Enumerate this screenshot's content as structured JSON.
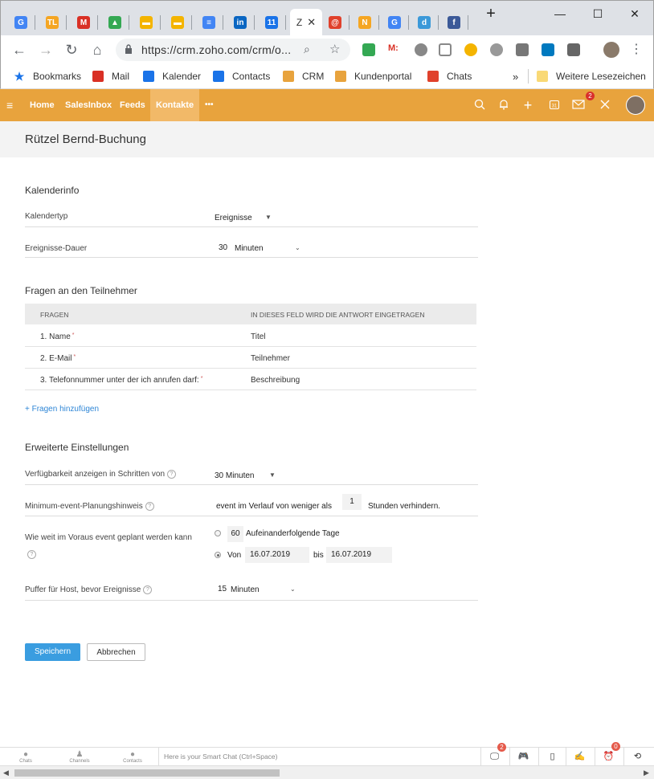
{
  "browser": {
    "active_tab_title": "Z",
    "tabs": [
      {
        "icon": "google-icon",
        "glyph": "G",
        "color": "#4285f4"
      },
      {
        "icon": "tl-icon",
        "glyph": "TL",
        "color": "#f5a623"
      },
      {
        "icon": "gmail-icon",
        "glyph": "M",
        "color": "#d93025"
      },
      {
        "icon": "google-drive-icon",
        "glyph": "▲",
        "color": "#34a853"
      },
      {
        "icon": "google-slides-icon",
        "glyph": "▬",
        "color": "#f4b400"
      },
      {
        "icon": "google-slides-icon",
        "glyph": "▬",
        "color": "#f4b400"
      },
      {
        "icon": "google-docs-icon",
        "glyph": "≡",
        "color": "#4285f4"
      },
      {
        "icon": "linkedin-icon",
        "glyph": "in",
        "color": "#0a66c2"
      },
      {
        "icon": "calendar-icon",
        "glyph": "11",
        "color": "#1a73e8"
      }
    ],
    "tabs_after": [
      {
        "icon": "zoho-chat-icon",
        "glyph": "@",
        "color": "#e0412c"
      },
      {
        "icon": "n-icon",
        "glyph": "N",
        "color": "#f5a623"
      },
      {
        "icon": "google-icon",
        "glyph": "G",
        "color": "#4285f4"
      },
      {
        "icon": "d-icon",
        "glyph": "d",
        "color": "#3b99d9"
      },
      {
        "icon": "facebook-icon",
        "glyph": "f",
        "color": "#3b5998"
      }
    ],
    "url": "https://crm.zoho.com/crm/o...",
    "bookmarks": [
      {
        "label": "Bookmarks",
        "icon": "star-icon",
        "color": "#1a73e8"
      },
      {
        "label": "Mail",
        "icon": "gmail-icon",
        "color": "#d93025"
      },
      {
        "label": "Kalender",
        "icon": "calendar-icon",
        "color": "#1a73e8"
      },
      {
        "label": "Contacts",
        "icon": "contacts-icon",
        "color": "#1a73e8"
      },
      {
        "label": "CRM",
        "icon": "handshake-icon",
        "color": "#e8a33d"
      },
      {
        "label": "Kundenportal",
        "icon": "handshake-icon",
        "color": "#e8a33d"
      },
      {
        "label": "Chats",
        "icon": "zoho-chat-icon",
        "color": "#e0412c"
      }
    ],
    "more_bookmarks": "»",
    "other_bookmarks": "Weitere Lesezeichen"
  },
  "crm": {
    "nav": [
      "Home",
      "SalesInbox",
      "Feeds",
      "Kontakte"
    ],
    "more": "•••",
    "mail_badge": "2",
    "accent": "#e8a33d"
  },
  "page": {
    "title": "Rützel Bernd-Buchung",
    "kalenderinfo": {
      "heading": "Kalenderinfo",
      "kalendertyp_label": "Kalendertyp",
      "kalendertyp_value": "Ereignisse",
      "dauer_label": "Ereignisse-Dauer",
      "dauer_value": "30",
      "dauer_unit": "Minuten"
    },
    "fragen": {
      "heading": "Fragen an den Teilnehmer",
      "col1": "FRAGEN",
      "col2": "IN DIESES FELD WIRD DIE ANTWORT EINGETRAGEN",
      "rows": [
        {
          "q": "1. Name",
          "a": "Titel"
        },
        {
          "q": "2. E-Mail",
          "a": "Teilnehmer"
        },
        {
          "q": "3. Telefonnummer unter der ich anrufen darf:",
          "a": "Beschreibung"
        }
      ],
      "add_link": "+ Fragen hinzufügen",
      "required_mark": "*"
    },
    "erweitert": {
      "heading": "Erweiterte Einstellungen",
      "schritte_label": "Verfügbarkeit anzeigen in Schritten von",
      "schritte_value": "30 Minuten",
      "planung_label": "Minimum-event-Planungshinweis",
      "planung_prefix": "event im Verlauf von weniger als",
      "planung_value": "1",
      "planung_suffix": "Stunden verhindern.",
      "voraus_label": "Wie weit im Voraus event geplant werden kann",
      "voraus_days_value": "60",
      "voraus_days_label": "Aufeinanderfolgende Tage",
      "von_label": "Von",
      "von_value": "16.07.2019",
      "bis_label": "bis",
      "bis_value": "16.07.2019",
      "puffer_label": "Puffer für Host, bevor Ereignisse",
      "puffer_value": "15",
      "puffer_unit": "Minuten"
    },
    "buttons": {
      "save": "Speichern",
      "cancel": "Abbrechen"
    }
  },
  "chatbar": {
    "chats": "Chats",
    "channels": "Channels",
    "contacts": "Contacts",
    "placeholder": "Here is your Smart Chat (Ctrl+Space)",
    "badge1": "2",
    "badge2": "0"
  }
}
